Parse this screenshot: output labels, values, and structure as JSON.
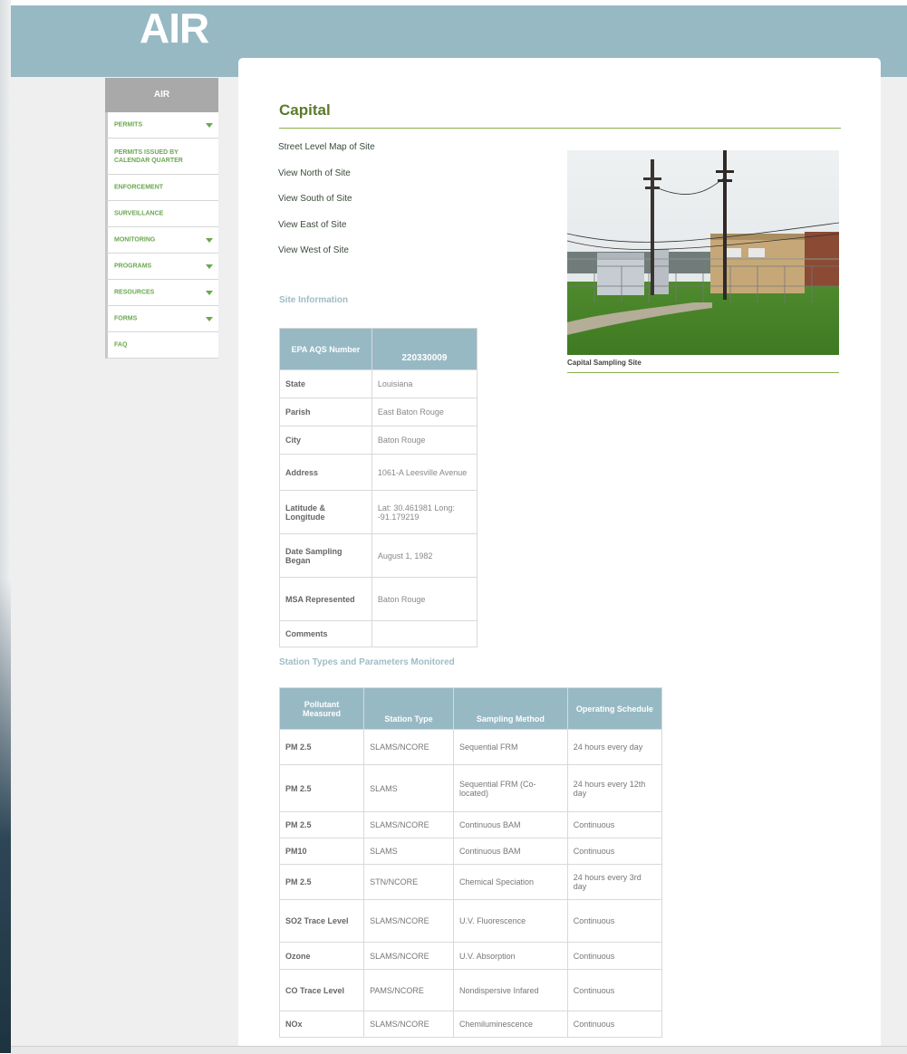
{
  "header": {
    "title": "AIR"
  },
  "sidebar": {
    "heading": "AIR",
    "items": [
      {
        "label": "PERMITS",
        "has_submenu": true
      },
      {
        "label": "PERMITS ISSUED BY CALENDAR QUARTER",
        "has_submenu": false
      },
      {
        "label": "ENFORCEMENT",
        "has_submenu": false
      },
      {
        "label": "SURVEILLANCE",
        "has_submenu": false
      },
      {
        "label": "MONITORING",
        "has_submenu": true
      },
      {
        "label": "PROGRAMS",
        "has_submenu": true
      },
      {
        "label": "RESOURCES",
        "has_submenu": true
      },
      {
        "label": "FORMS",
        "has_submenu": true
      },
      {
        "label": "FAQ",
        "has_submenu": false
      }
    ]
  },
  "main": {
    "title": "Capital",
    "links": [
      "Street Level Map of Site",
      "View North of Site",
      "View South of Site",
      "View East of Site",
      "View West of Site"
    ],
    "site_info_heading": "Site Information",
    "photo_caption": "Capital Sampling Site",
    "site_table": {
      "header_label": "EPA AQS Number",
      "header_value": "220330009",
      "rows": [
        {
          "label": "State",
          "value": "Louisiana"
        },
        {
          "label": "Parish",
          "value": "East Baton Rouge"
        },
        {
          "label": "City",
          "value": "Baton Rouge"
        },
        {
          "label": "Address",
          "value": "1061-A Leesville Avenue"
        },
        {
          "label": "Latitude & Longitude",
          "value": "Lat: 30.461981 Long: -91.179219"
        },
        {
          "label": "Date Sampling Began",
          "value": "August 1, 1982"
        },
        {
          "label": "MSA Represented",
          "value": "Baton Rouge"
        },
        {
          "label": "Comments",
          "value": ""
        }
      ]
    },
    "station_heading": "Station Types and Parameters Monitored",
    "station_table": {
      "headers": [
        "Pollutant Measured",
        "Station Type",
        "Sampling Method",
        "Operating Schedule"
      ],
      "rows": [
        [
          "PM 2.5",
          "SLAMS/NCORE",
          "Sequential FRM",
          "24 hours every day"
        ],
        [
          "PM 2.5",
          "SLAMS",
          "Sequential FRM (Co-located)",
          "24 hours every 12th day"
        ],
        [
          "PM 2.5",
          "SLAMS/NCORE",
          "Continuous BAM",
          "Continuous"
        ],
        [
          "PM10",
          "SLAMS",
          "Continuous BAM",
          "Continuous"
        ],
        [
          "PM 2.5",
          "STN/NCORE",
          "Chemical Speciation",
          "24 hours every 3rd day"
        ],
        [
          "SO2 Trace Level",
          "SLAMS/NCORE",
          "U.V. Fluorescence",
          "Continuous"
        ],
        [
          "Ozone",
          "SLAMS/NCORE",
          "U.V. Absorption",
          "Continuous"
        ],
        [
          "CO Trace Level",
          "PAMS/NCORE",
          "Nondispersive Infared",
          "Continuous"
        ],
        [
          "NOx",
          "SLAMS/NCORE",
          "Chemiluminescence",
          "Continuous"
        ]
      ]
    }
  },
  "colors": {
    "header_bg": "#97b9c4",
    "accent_green": "#6aa84f",
    "title_green": "#5c7a2b",
    "table_header_bg": "#97b9c4"
  }
}
